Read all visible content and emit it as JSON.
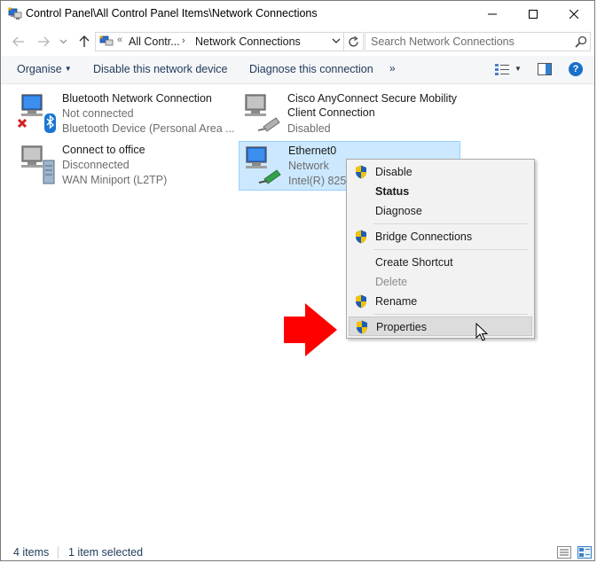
{
  "window": {
    "title": "Control Panel\\All Control Panel Items\\Network Connections"
  },
  "address": {
    "overflow": "«",
    "segment1": "All Contr...",
    "separator": "›",
    "segment2": "Network Connections"
  },
  "search": {
    "placeholder": "Search Network Connections"
  },
  "toolbar": {
    "organise": "Organise",
    "disable_device": "Disable this network device",
    "diagnose": "Diagnose this connection",
    "more": "»"
  },
  "connections": [
    {
      "name": "Bluetooth Network Connection",
      "status": "Not connected",
      "device": "Bluetooth Device (Personal Area ..."
    },
    {
      "name": "Cisco AnyConnect Secure Mobility",
      "name2": "Client Connection",
      "status": "Disabled"
    },
    {
      "name": "Connect to office",
      "status": "Disconnected",
      "device": "WAN Miniport (L2TP)"
    },
    {
      "name": "Ethernet0",
      "status": "Network",
      "device": "Intel(R) 825"
    }
  ],
  "context_menu": {
    "items": [
      {
        "label": "Disable",
        "icon": "shield-icon"
      },
      {
        "label": "Status"
      },
      {
        "label": "Diagnose"
      },
      {
        "label": "Bridge Connections",
        "icon": "shield-icon"
      },
      {
        "label": "Create Shortcut"
      },
      {
        "label": "Delete"
      },
      {
        "label": "Rename",
        "icon": "shield-icon"
      },
      {
        "label": "Properties",
        "icon": "shield-icon"
      }
    ]
  },
  "status_bar": {
    "count": "4 items",
    "selected": "1 item selected"
  },
  "colors": {
    "selection_bg": "#cce8ff",
    "selection_border": "#99d1ff",
    "link_text": "#1e395b",
    "arrow": "#ff0000",
    "help": "#1a6fc9"
  },
  "icons": [
    "network-connections-icon",
    "back-arrow-icon",
    "forward-arrow-icon",
    "recent-chevron-icon",
    "up-arrow-icon",
    "refresh-icon",
    "search-icon",
    "view-options-icon",
    "preview-pane-icon",
    "help-icon",
    "details-view-icon",
    "tiles-view-icon"
  ]
}
